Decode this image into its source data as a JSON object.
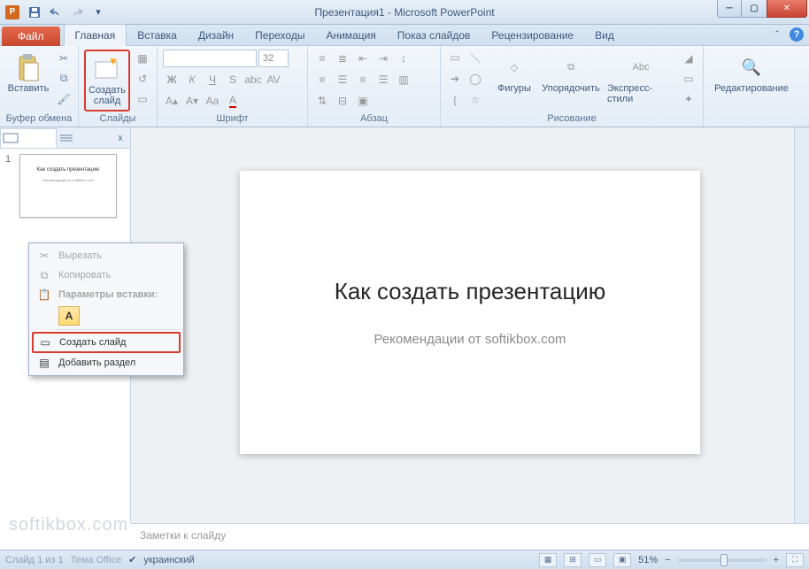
{
  "title": "Презентация1 - Microsoft PowerPoint",
  "app_initial": "P",
  "tabs": {
    "file": "Файл",
    "list": [
      "Главная",
      "Вставка",
      "Дизайн",
      "Переходы",
      "Анимация",
      "Показ слайдов",
      "Рецензирование",
      "Вид"
    ],
    "active": 0
  },
  "ribbon": {
    "clipboard": {
      "paste": "Вставить",
      "group": "Буфер обмена"
    },
    "slides": {
      "new_slide": "Создать",
      "new_slide2": "слайд",
      "group": "Слайды"
    },
    "font": {
      "group": "Шрифт",
      "size_placeholder": "32"
    },
    "para": {
      "group": "Абзац"
    },
    "drawing": {
      "shapes": "Фигуры",
      "arrange": "Упорядочить",
      "styles": "Экспресс-стили",
      "group": "Рисование"
    },
    "editing": {
      "label": "Редактирование"
    }
  },
  "panel": {
    "tab_close": "x"
  },
  "thumb": {
    "num": "1",
    "title": "Как создать презентацию",
    "sub": "Рекомендации от softikbox.com"
  },
  "slide": {
    "title": "Как создать презентацию",
    "subtitle": "Рекомендации от softikbox.com"
  },
  "notes": {
    "placeholder": "Заметки к слайду"
  },
  "context": {
    "cut": "Вырезать",
    "copy": "Копировать",
    "paste_opts": "Параметры вставки:",
    "paste_a": "A",
    "new_slide": "Создать слайд",
    "add_section": "Добавить раздел"
  },
  "status": {
    "slide_info": "Слайд 1 из 1",
    "theme": "Тема Office",
    "lang": "украинский",
    "zoom": "51%"
  },
  "watermark": "softikbox.com",
  "icons": {
    "find": "🔍"
  }
}
